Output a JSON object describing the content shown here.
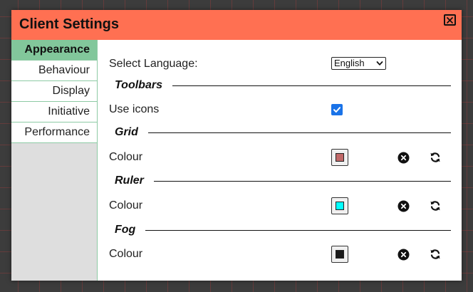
{
  "dialog": {
    "title": "Client Settings",
    "close_icon": "close-icon"
  },
  "sidebar": {
    "items": [
      {
        "label": "Appearance",
        "active": true
      },
      {
        "label": "Behaviour",
        "active": false
      },
      {
        "label": "Display",
        "active": false
      },
      {
        "label": "Initiative",
        "active": false
      },
      {
        "label": "Performance",
        "active": false
      }
    ]
  },
  "content": {
    "language": {
      "label": "Select Language:",
      "value": "English"
    },
    "toolbars": {
      "heading": "Toolbars",
      "use_icons_label": "Use icons",
      "use_icons_checked": true
    },
    "grid": {
      "heading": "Grid",
      "colour_label": "Colour",
      "colour": "#c06868"
    },
    "ruler": {
      "heading": "Ruler",
      "colour_label": "Colour",
      "colour": "#00ffff"
    },
    "fog": {
      "heading": "Fog",
      "colour_label": "Colour",
      "colour": "#1a1a1a"
    }
  },
  "colors": {
    "titlebar": "#ff7052",
    "active_tab": "#82c79b",
    "checkbox": "#1a73e8"
  }
}
